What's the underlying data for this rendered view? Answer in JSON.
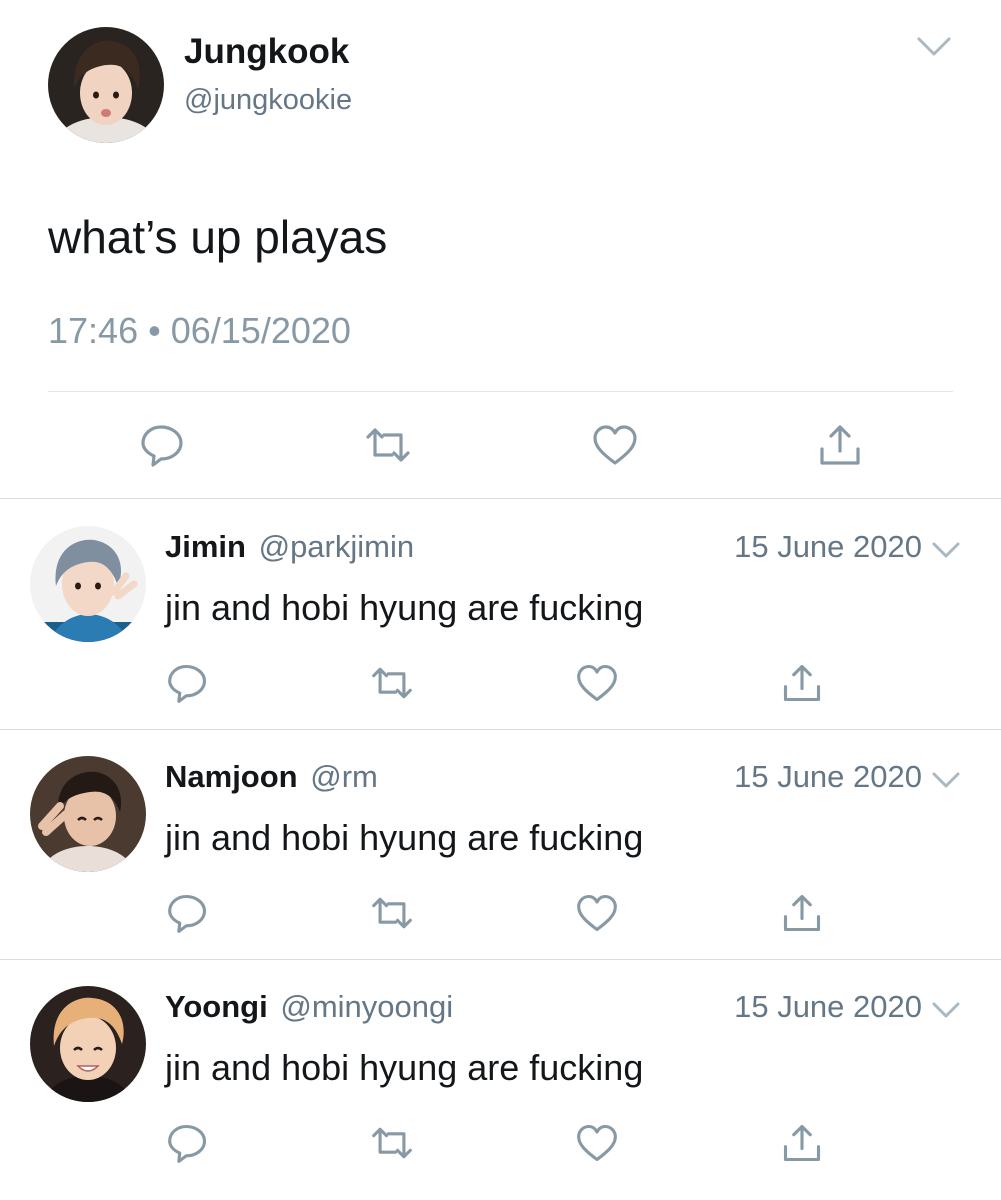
{
  "main_tweet": {
    "name": "Jungkook",
    "handle": "@jungkookie",
    "text": "what’s up playas",
    "time": "17:46",
    "separator": "•",
    "date": "06/15/2020",
    "icons": [
      "reply-icon",
      "retweet-icon",
      "like-icon",
      "share-icon",
      "chevron-down-icon"
    ]
  },
  "replies": [
    {
      "name": "Jimin",
      "handle": "@parkjimin",
      "date": "15 June 2020",
      "text": "jin and hobi hyung are fucking"
    },
    {
      "name": "Namjoon",
      "handle": "@rm",
      "date": "15 June 2020",
      "text": "jin and hobi hyung are fucking"
    },
    {
      "name": "Yoongi",
      "handle": "@minyoongi",
      "date": "15 June 2020",
      "text": "jin and hobi hyung are fucking"
    }
  ],
  "colors": {
    "text_primary": "#14171a",
    "text_secondary": "#657786",
    "icon_gray": "#8899a6",
    "divider": "#e1e8ed",
    "background": "#ffffff"
  }
}
